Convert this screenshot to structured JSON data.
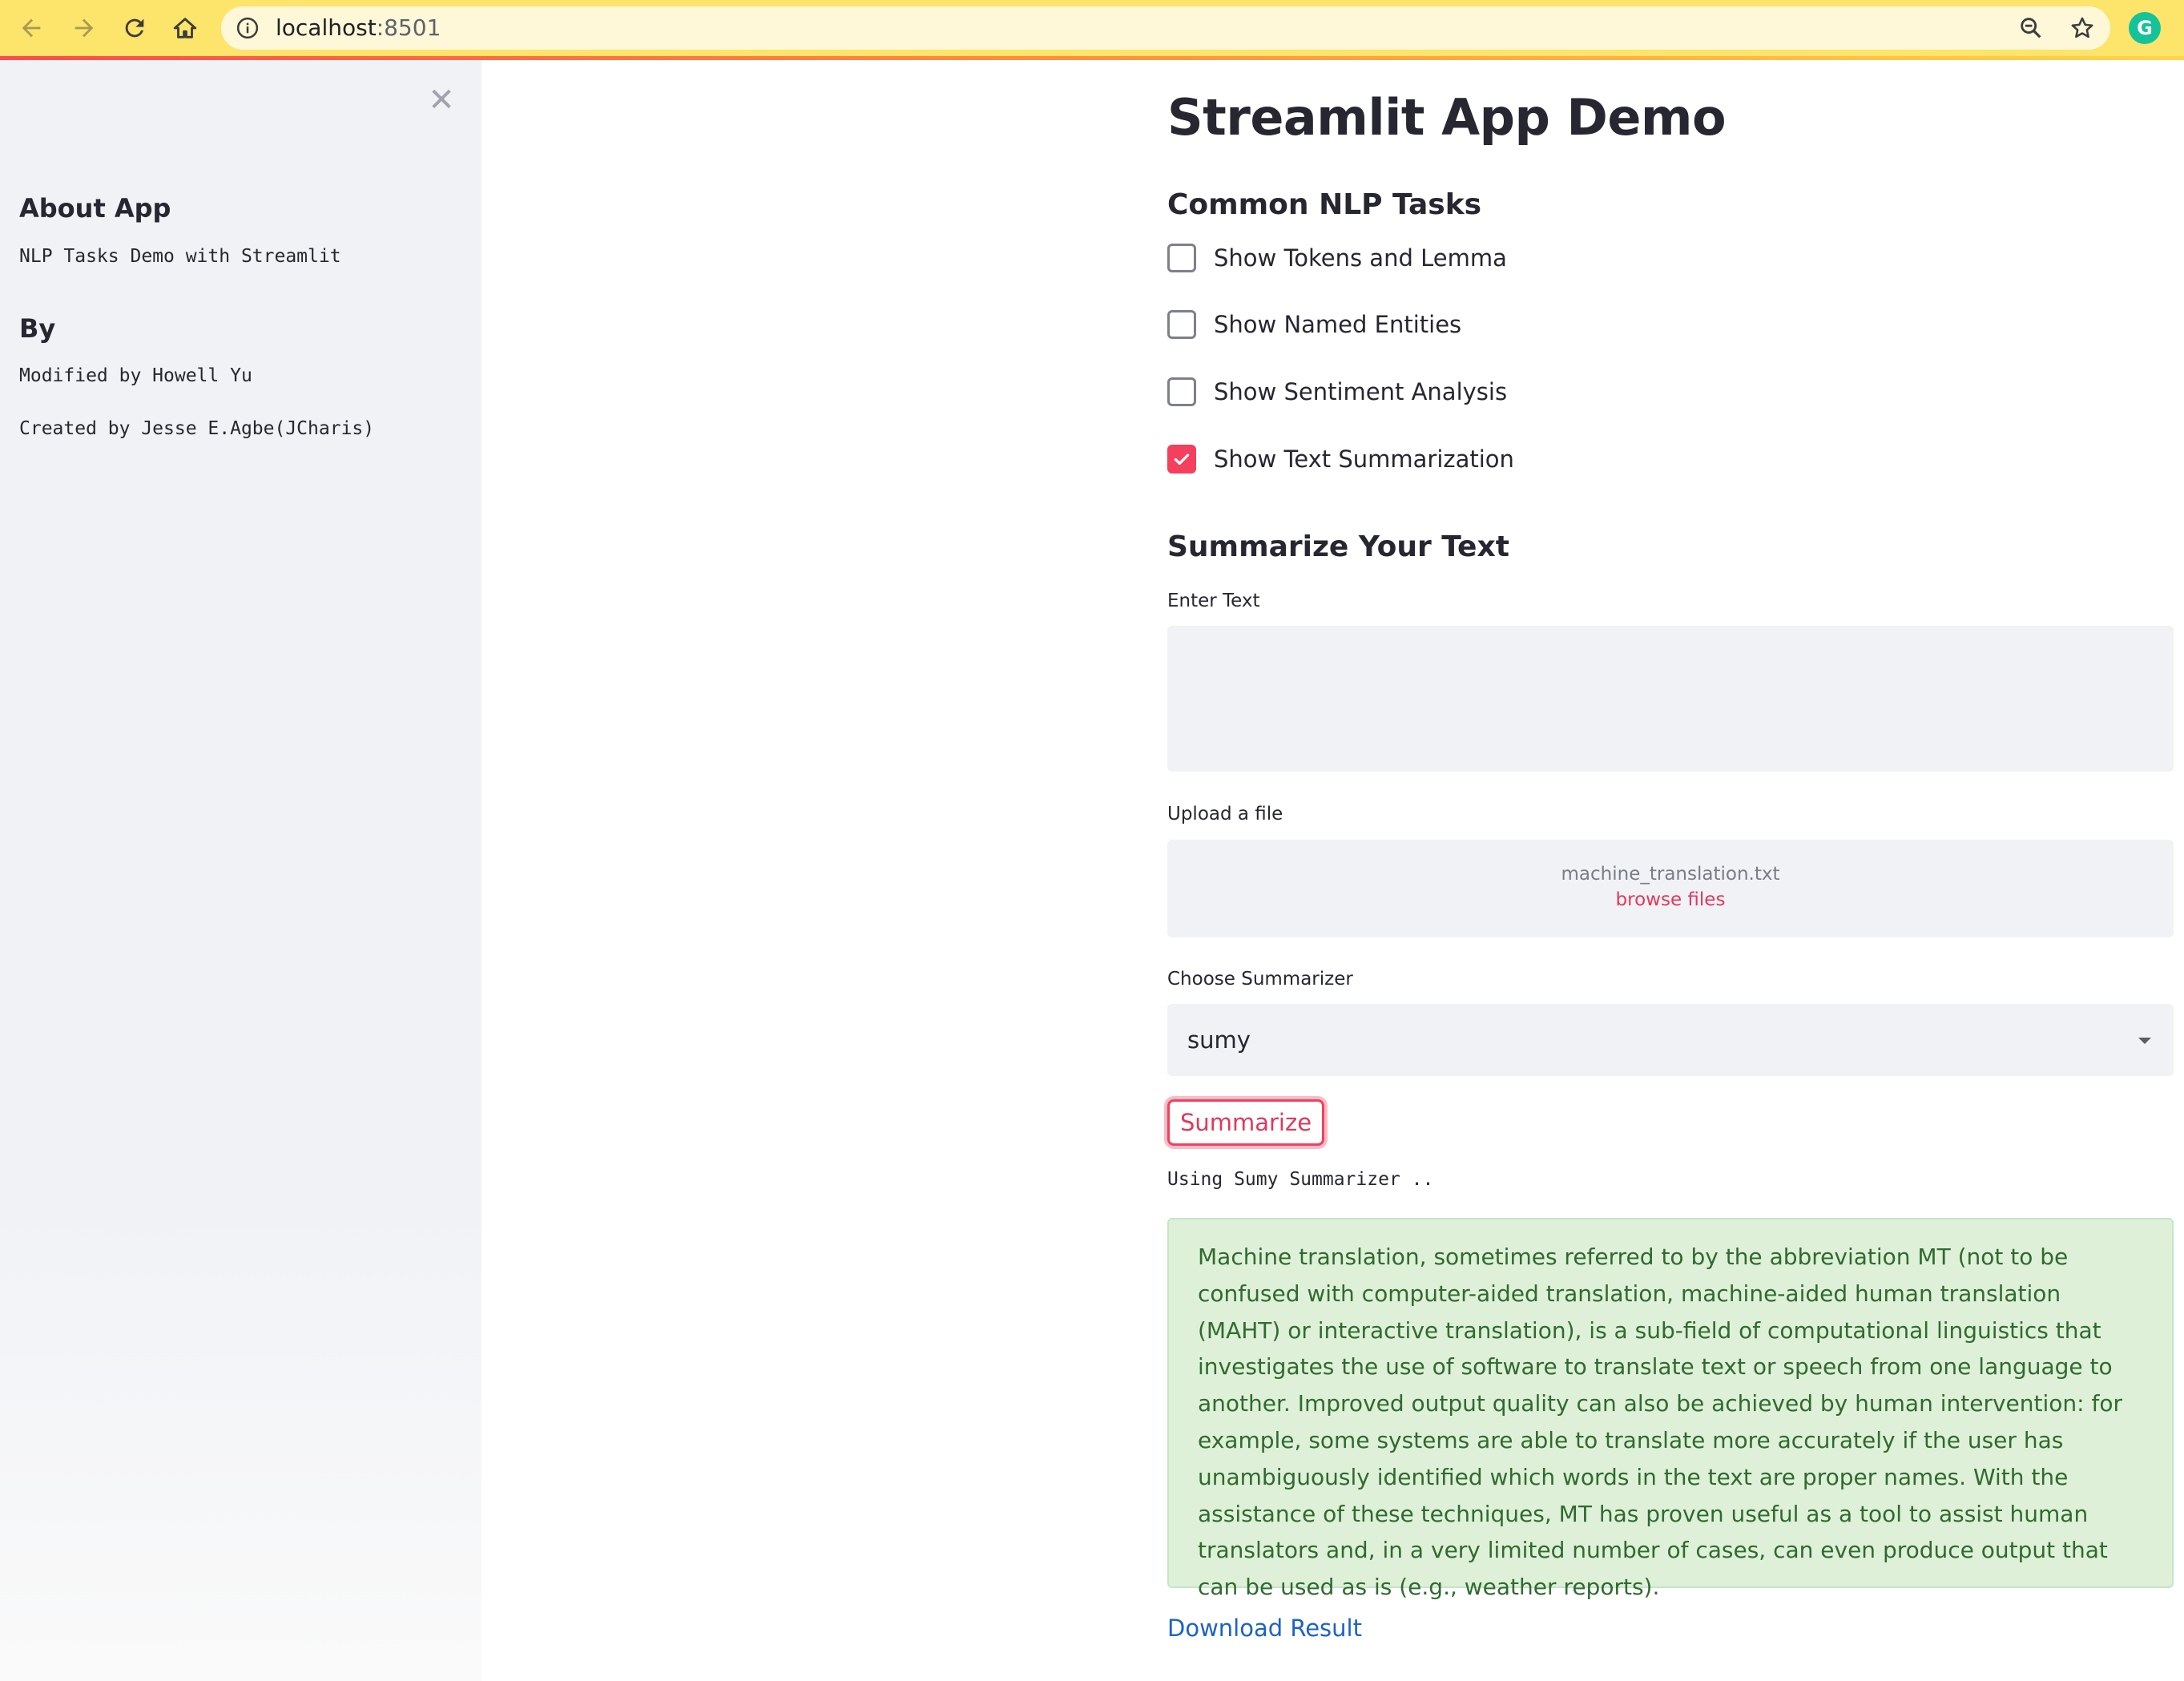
{
  "browser": {
    "url_host": "localhost",
    "url_port": ":8501",
    "extension_letter": "G"
  },
  "sidebar": {
    "about_heading": "About App",
    "about_text": "NLP Tasks Demo with Streamlit",
    "by_heading": "By",
    "modified_by": "Modified by Howell Yu",
    "created_by": "Created by Jesse E.Agbe(JCharis)",
    "close_symbol": "✕"
  },
  "main": {
    "title": "Streamlit App Demo",
    "tasks_heading": "Common NLP Tasks",
    "checkboxes": [
      {
        "label": "Show Tokens and Lemma",
        "checked": false
      },
      {
        "label": "Show Named Entities",
        "checked": false
      },
      {
        "label": "Show Sentiment Analysis",
        "checked": false
      },
      {
        "label": "Show Text Summarization",
        "checked": true
      }
    ],
    "summarize_heading": "Summarize Your Text",
    "enter_text_label": "Enter Text",
    "enter_text_value": "",
    "upload_label": "Upload a file",
    "upload_filename": "machine_translation.txt",
    "upload_browse": "browse files",
    "summarizer_label": "Choose Summarizer",
    "summarizer_value": "sumy",
    "summarize_button": "Summarize",
    "status_text": "Using Sumy Summarizer ..",
    "result_text": "Machine translation, sometimes referred to by the abbreviation MT (not to be confused with computer-aided translation, machine-aided human translation (MAHT) or interactive translation), is a sub-field of computational linguistics that investigates the use of software to translate text or speech from one language to another. Improved output quality can also be achieved by human intervention: for example, some systems are able to translate more accurately if the user has unambiguously identified which words in the text are proper names. With the assistance of these techniques, MT has proven useful as a tool to assist human translators and, in a very limited number of cases, can even produce output that can be used as is (e.g., weather reports).",
    "download_link": "Download Result"
  },
  "colors": {
    "accent": "#f43f5e",
    "success_bg": "#dff0d8",
    "success_text": "#2f6b2f",
    "link": "#1c62c8",
    "chrome_bar": "#fde46a"
  }
}
